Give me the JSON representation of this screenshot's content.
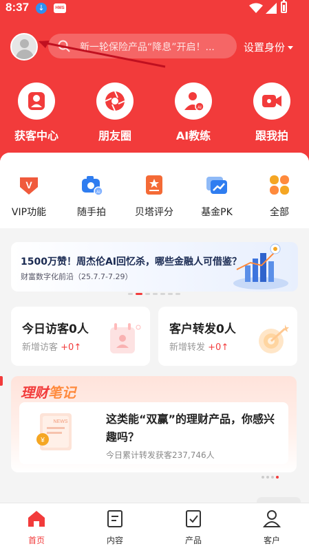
{
  "status_bar": {
    "time": "8:37",
    "hms_badge": "HMS"
  },
  "header": {
    "search_placeholder": "新一轮保险产品“降息”开启！...",
    "identity_button": "设置身份"
  },
  "quick_actions": [
    {
      "label": "获客中心",
      "icon": "user-center-icon"
    },
    {
      "label": "朋友圈",
      "icon": "aperture-icon"
    },
    {
      "label": "AI教练",
      "icon": "ai-coach-icon"
    },
    {
      "label": "跟我拍",
      "icon": "video-camera-icon"
    }
  ],
  "functions": [
    {
      "label": "VIP功能",
      "icon": "vip-badge-icon"
    },
    {
      "label": "随手拍",
      "icon": "ai-camera-icon"
    },
    {
      "label": "贝塔评分",
      "icon": "score-doc-icon"
    },
    {
      "label": "基金PK",
      "icon": "fund-chart-icon"
    },
    {
      "label": "全部",
      "icon": "grid-all-icon"
    }
  ],
  "banner": {
    "title": "1500万赞！周杰伦AI回忆杀，哪些金融人可借鉴？",
    "subtitle": "财富数字化前沿（25.7.7-7.29）"
  },
  "stats": [
    {
      "title": "今日访客0人",
      "sub_label": "新增访客",
      "delta": "+0"
    },
    {
      "title": "客户转发0人",
      "sub_label": "新增转发",
      "delta": "+0"
    }
  ],
  "finance_note": {
    "brand_a": "理财",
    "brand_b": "笔记",
    "card_title": "这类能“双赢”的理财产品，你感兴趣吗？",
    "card_sub": "今日累计转发获客237,746人",
    "thumb_text": "NEWS"
  },
  "tabbar": [
    {
      "label": "首页",
      "active": true
    },
    {
      "label": "内容",
      "active": false
    },
    {
      "label": "产品",
      "active": false
    },
    {
      "label": "客户",
      "active": false
    }
  ],
  "colors": {
    "brand_red": "#f23b3b",
    "accent_orange": "#ff8a3c",
    "fund_blue": "#2f7df0"
  }
}
